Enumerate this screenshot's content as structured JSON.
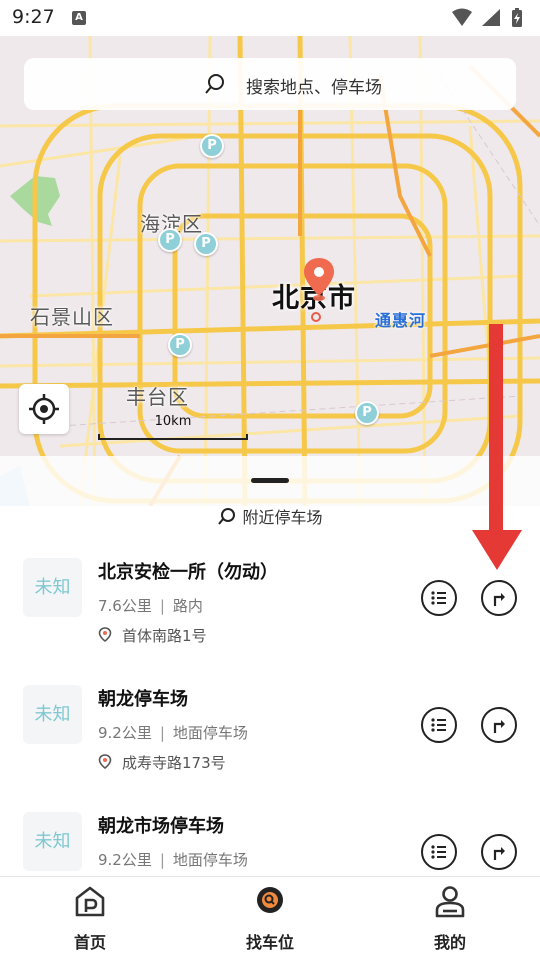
{
  "status_bar": {
    "time": "9:27",
    "notification_badge": "A",
    "icons": [
      "wifi-icon",
      "signal-icon",
      "battery-charging-icon"
    ]
  },
  "map": {
    "search_placeholder": "搜索地点、停车场",
    "labels": {
      "haidian": "海淀区",
      "shijingshan": "石景山区",
      "fengtai": "丰台区",
      "city": "北京市",
      "river": "通惠河"
    },
    "parking_marker_text": "P",
    "scale": "10km"
  },
  "list": {
    "header": "附近停车场",
    "items": [
      {
        "status": "未知",
        "name": "北京安检一所（勿动）",
        "distance": "7.6公里",
        "type": "路内",
        "address": "首体南路1号"
      },
      {
        "status": "未知",
        "name": "朝龙停车场",
        "distance": "9.2公里",
        "type": "地面停车场",
        "address": "成寿寺路173号"
      },
      {
        "status": "未知",
        "name": "朝龙市场停车场",
        "distance": "9.2公里",
        "type": "地面停车场",
        "address": ""
      }
    ]
  },
  "bottom_nav": {
    "items": [
      {
        "label": "首页",
        "icon": "parking-home-icon"
      },
      {
        "label": "找车位",
        "icon": "find-parking-icon",
        "active": true
      },
      {
        "label": "我的",
        "icon": "profile-icon"
      }
    ]
  },
  "colors": {
    "accent": "#f08a3c",
    "pin": "#ef6a4f",
    "parking_marker": "#8fd0d8",
    "status_text": "#7fc8d2",
    "annotation_arrow": "#e53935"
  }
}
